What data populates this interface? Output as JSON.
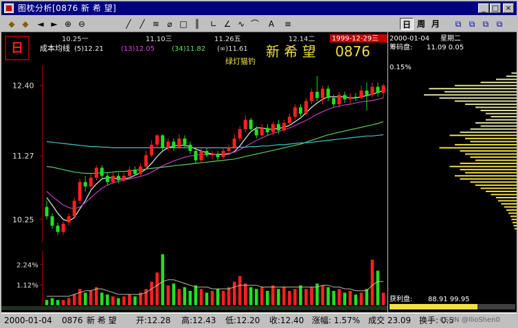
{
  "window": {
    "title": "图枕分析[0876 新 希 望]",
    "min": "_",
    "max": "□",
    "close": "×"
  },
  "toolbar": {
    "tools": [
      "◆",
      "◆",
      "◄",
      "►",
      "⊕",
      "⊖",
      "╱",
      "╱",
      "≋",
      "⌀",
      "□",
      "║",
      "∟",
      "∠",
      "∿",
      "⌒",
      "A",
      "≡"
    ],
    "periods": [
      "日",
      "周",
      "月"
    ],
    "views": [
      "⧉",
      "⧉",
      "⧉",
      "⧉"
    ]
  },
  "chart_header": {
    "dates": [
      "10.25一",
      "11.10三",
      "11.26五",
      "12.14二"
    ],
    "current_date": "1999-12-29三",
    "indicator_label": "成本均线",
    "ma": [
      {
        "label": "(5)12.21",
        "color": "#f0f0f0"
      },
      {
        "label": "(13)12.05",
        "color": "#e040e0"
      },
      {
        "label": "(34)11.82",
        "color": "#60e060"
      },
      {
        "label": "(∞)11.61",
        "color": "#e0e0e0"
      }
    ],
    "stock_name": "新 希 望",
    "stock_code": "0876",
    "signal_label": "绿灯猫钓"
  },
  "chart_data": {
    "type": "candlestick",
    "title": "",
    "y_ticks": [
      12.4,
      11.27,
      10.25
    ],
    "ylim": [
      9.95,
      12.65
    ],
    "candles": [
      [
        10.45,
        10.3,
        10.55,
        10.25
      ],
      [
        10.3,
        10.15,
        10.35,
        10.1
      ],
      [
        10.15,
        10.05,
        10.2,
        10.0
      ],
      [
        10.05,
        10.18,
        10.22,
        10.0
      ],
      [
        10.2,
        10.3,
        10.35,
        10.15
      ],
      [
        10.3,
        10.55,
        10.6,
        10.28
      ],
      [
        10.55,
        10.85,
        10.9,
        10.5
      ],
      [
        10.85,
        10.78,
        10.95,
        10.7
      ],
      [
        10.78,
        10.92,
        10.98,
        10.75
      ],
      [
        10.92,
        11.08,
        11.12,
        10.88
      ],
      [
        11.08,
        10.95,
        11.12,
        10.9
      ],
      [
        10.95,
        10.85,
        11.0,
        10.8
      ],
      [
        10.85,
        10.95,
        11.0,
        10.82
      ],
      [
        10.95,
        10.88,
        11.0,
        10.83
      ],
      [
        10.88,
        10.95,
        11.0,
        10.85
      ],
      [
        10.95,
        11.05,
        11.1,
        10.9
      ],
      [
        11.05,
        10.98,
        11.1,
        10.95
      ],
      [
        10.98,
        11.1,
        11.15,
        10.95
      ],
      [
        11.1,
        11.28,
        11.35,
        11.05
      ],
      [
        11.28,
        11.45,
        11.52,
        11.25
      ],
      [
        11.45,
        11.6,
        11.62,
        11.4
      ],
      [
        11.6,
        11.4,
        11.62,
        11.35
      ],
      [
        11.4,
        11.5,
        11.55,
        11.35
      ],
      [
        11.5,
        11.4,
        11.55,
        11.35
      ],
      [
        11.4,
        11.55,
        11.62,
        11.38
      ],
      [
        11.55,
        11.45,
        11.6,
        11.4
      ],
      [
        11.45,
        11.35,
        11.5,
        11.3
      ],
      [
        11.35,
        11.2,
        11.4,
        11.15
      ],
      [
        11.2,
        11.35,
        11.4,
        11.15
      ],
      [
        11.35,
        11.28,
        11.4,
        11.25
      ],
      [
        11.28,
        11.3,
        11.35,
        11.22
      ],
      [
        11.3,
        11.25,
        11.35,
        11.2
      ],
      [
        11.25,
        11.35,
        11.4,
        11.22
      ],
      [
        11.35,
        11.4,
        11.45,
        11.3
      ],
      [
        11.4,
        11.55,
        11.62,
        11.38
      ],
      [
        11.55,
        11.7,
        11.75,
        11.5
      ],
      [
        11.7,
        11.85,
        11.92,
        11.65
      ],
      [
        11.85,
        11.7,
        11.88,
        11.65
      ],
      [
        11.7,
        11.6,
        11.75,
        11.55
      ],
      [
        11.6,
        11.72,
        11.78,
        11.58
      ],
      [
        11.72,
        11.65,
        11.78,
        11.6
      ],
      [
        11.65,
        11.78,
        11.82,
        11.6
      ],
      [
        11.78,
        11.68,
        11.85,
        11.62
      ],
      [
        11.68,
        11.8,
        11.85,
        11.65
      ],
      [
        11.8,
        11.9,
        11.95,
        11.75
      ],
      [
        11.9,
        12.05,
        12.1,
        11.85
      ],
      [
        12.05,
        11.95,
        12.1,
        11.9
      ],
      [
        11.95,
        12.15,
        12.2,
        11.92
      ],
      [
        12.15,
        12.3,
        12.35,
        12.1
      ],
      [
        12.3,
        12.2,
        12.55,
        12.15
      ],
      [
        12.2,
        12.35,
        12.4,
        12.1
      ],
      [
        12.35,
        12.2,
        12.4,
        12.15
      ],
      [
        12.2,
        12.1,
        12.25,
        12.05
      ],
      [
        12.1,
        12.25,
        12.3,
        12.05
      ],
      [
        12.25,
        12.18,
        12.3,
        12.12
      ],
      [
        12.18,
        12.22,
        12.28,
        12.1
      ],
      [
        12.22,
        12.2,
        12.28,
        12.15
      ],
      [
        12.2,
        12.32,
        12.4,
        12.18
      ],
      [
        12.32,
        12.25,
        12.45,
        12.0
      ],
      [
        12.25,
        12.38,
        12.45,
        12.2
      ],
      [
        12.38,
        12.28,
        12.45,
        12.22
      ],
      [
        12.28,
        12.4,
        12.43,
        12.2
      ]
    ],
    "ma_lines": [
      {
        "name": "(5)",
        "color": "#f0f0f0",
        "values": [
          10.6,
          10.48,
          10.35,
          10.25,
          10.22,
          10.28,
          10.42,
          10.55,
          10.72,
          10.82,
          10.9,
          10.92,
          10.92,
          10.9,
          10.9,
          10.92,
          10.96,
          11.0,
          11.06,
          11.15,
          11.26,
          11.35,
          11.4,
          11.43,
          11.44,
          11.44,
          11.42,
          11.38,
          11.35,
          11.32,
          11.3,
          11.29,
          11.29,
          11.3,
          11.34,
          11.43,
          11.55,
          11.66,
          11.72,
          11.72,
          11.7,
          11.7,
          11.71,
          11.73,
          11.76,
          11.82,
          11.88,
          11.96,
          12.05,
          12.12,
          12.18,
          12.22,
          12.22,
          12.22,
          12.22,
          12.2,
          12.2,
          12.22,
          12.24,
          12.26,
          12.29,
          12.32
        ]
      },
      {
        "name": "(13)",
        "color": "#c040c0",
        "values": [
          10.7,
          10.62,
          10.55,
          10.48,
          10.44,
          10.42,
          10.45,
          10.52,
          10.6,
          10.68,
          10.75,
          10.8,
          10.84,
          10.86,
          10.88,
          10.9,
          10.92,
          10.94,
          10.97,
          11.01,
          11.06,
          11.11,
          11.15,
          11.19,
          11.22,
          11.25,
          11.27,
          11.28,
          11.29,
          11.29,
          11.29,
          11.3,
          11.3,
          11.31,
          11.33,
          11.37,
          11.42,
          11.47,
          11.52,
          11.56,
          11.6,
          11.63,
          11.66,
          11.69,
          11.72,
          11.76,
          11.8,
          11.84,
          11.89,
          11.94,
          11.98,
          12.02,
          12.05,
          12.07,
          12.09,
          12.1,
          12.12,
          12.14,
          12.15,
          12.16,
          12.18,
          12.2
        ]
      },
      {
        "name": "(34)",
        "color": "#60d060",
        "values": [
          11.1,
          11.09,
          11.07,
          11.05,
          11.03,
          11.01,
          11.0,
          10.99,
          10.99,
          10.99,
          11.0,
          11.0,
          11.01,
          11.02,
          11.02,
          11.03,
          11.04,
          11.05,
          11.06,
          11.07,
          11.08,
          11.09,
          11.1,
          11.11,
          11.12,
          11.13,
          11.14,
          11.15,
          11.16,
          11.17,
          11.18,
          11.19,
          11.2,
          11.21,
          11.22,
          11.24,
          11.26,
          11.28,
          11.3,
          11.32,
          11.34,
          11.36,
          11.38,
          11.4,
          11.42,
          11.44,
          11.46,
          11.49,
          11.52,
          11.55,
          11.58,
          11.61,
          11.63,
          11.65,
          11.67,
          11.69,
          11.71,
          11.73,
          11.75,
          11.77,
          11.79,
          11.82
        ]
      },
      {
        "name": "(∞)",
        "color": "#40c8c8",
        "values": [
          11.5,
          11.49,
          11.48,
          11.47,
          11.46,
          11.45,
          11.44,
          11.43,
          11.42,
          11.42,
          11.41,
          11.41,
          11.4,
          11.4,
          11.4,
          11.4,
          11.4,
          11.4,
          11.4,
          11.4,
          11.4,
          11.4,
          11.4,
          11.4,
          11.4,
          11.4,
          11.4,
          11.4,
          11.4,
          11.4,
          11.4,
          11.4,
          11.4,
          11.4,
          11.4,
          11.41,
          11.41,
          11.42,
          11.42,
          11.43,
          11.43,
          11.44,
          11.45,
          11.45,
          11.46,
          11.47,
          11.48,
          11.48,
          11.49,
          11.5,
          11.51,
          11.52,
          11.53,
          11.54,
          11.55,
          11.56,
          11.57,
          11.58,
          11.59,
          11.59,
          11.6,
          11.61
        ]
      }
    ],
    "volume_ticks": [
      "2.24%",
      "1.12%"
    ],
    "volume_ylim": [
      0,
      3.0
    ],
    "volume": [
      0.3,
      0.4,
      0.3,
      0.3,
      0.4,
      0.6,
      0.9,
      0.7,
      0.8,
      1.0,
      0.7,
      0.6,
      0.5,
      0.4,
      0.5,
      0.6,
      0.5,
      0.7,
      0.9,
      1.3,
      1.8,
      2.8,
      1.1,
      1.2,
      0.9,
      1.0,
      0.8,
      1.1,
      0.9,
      0.7,
      0.8,
      0.9,
      0.8,
      1.0,
      1.3,
      1.6,
      1.2,
      1.0,
      0.9,
      1.0,
      0.8,
      1.1,
      0.9,
      1.0,
      0.8,
      0.9,
      1.1,
      0.9,
      1.0,
      1.2,
      1.1,
      1.0,
      0.8,
      0.9,
      0.7,
      0.8,
      0.6,
      0.7,
      0.9,
      2.5,
      1.9,
      0.7
    ],
    "volume_ma": [
      0.5,
      0.5,
      0.5,
      0.5,
      0.5,
      0.6,
      0.7,
      0.8,
      0.8,
      0.9,
      0.9,
      0.8,
      0.7,
      0.6,
      0.6,
      0.6,
      0.6,
      0.6,
      0.7,
      0.9,
      1.1,
      1.3,
      1.4,
      1.4,
      1.3,
      1.2,
      1.1,
      1.0,
      1.0,
      1.0,
      0.9,
      0.9,
      0.9,
      0.9,
      1.0,
      1.1,
      1.1,
      1.1,
      1.1,
      1.0,
      1.0,
      1.0,
      1.0,
      1.0,
      1.0,
      1.0,
      1.0,
      1.0,
      1.0,
      1.0,
      1.1,
      1.1,
      1.0,
      1.0,
      0.9,
      0.9,
      0.8,
      0.8,
      0.8,
      1.1,
      1.3,
      1.3
    ]
  },
  "side": {
    "date": "2000-01-04",
    "weekday": "星期二",
    "range_label": "筹码盘:",
    "range_values": "11.09 0.05",
    "pct": "0.15%",
    "profit_label": "获利盘:",
    "profit_values": "88.91 99.95",
    "distribution": [
      {
        "price": 12.6,
        "v": 0.05
      },
      {
        "price": 12.55,
        "v": 0.1
      },
      {
        "price": 12.5,
        "v": 0.2
      },
      {
        "price": 12.45,
        "v": 0.35
      },
      {
        "price": 12.4,
        "v": 0.6
      },
      {
        "price": 12.35,
        "v": 0.85
      },
      {
        "price": 12.3,
        "v": 0.7
      },
      {
        "price": 12.25,
        "v": 0.9
      },
      {
        "price": 12.2,
        "v": 0.75
      },
      {
        "price": 12.15,
        "v": 0.6
      },
      {
        "price": 12.1,
        "v": 0.5
      },
      {
        "price": 12.05,
        "v": 0.4
      },
      {
        "price": 12.0,
        "v": 0.35
      },
      {
        "price": 11.95,
        "v": 0.3
      },
      {
        "price": 11.9,
        "v": 0.25
      },
      {
        "price": 11.85,
        "v": 0.3
      },
      {
        "price": 11.8,
        "v": 0.4
      },
      {
        "price": 11.75,
        "v": 0.35
      },
      {
        "price": 11.7,
        "v": 0.45
      },
      {
        "price": 11.65,
        "v": 0.55
      },
      {
        "price": 11.6,
        "v": 0.65
      },
      {
        "price": 11.55,
        "v": 0.5
      },
      {
        "price": 11.5,
        "v": 0.45
      },
      {
        "price": 11.45,
        "v": 0.6
      },
      {
        "price": 11.4,
        "v": 0.75
      },
      {
        "price": 11.35,
        "v": 0.55
      },
      {
        "price": 11.3,
        "v": 0.5
      },
      {
        "price": 11.25,
        "v": 0.45
      },
      {
        "price": 11.2,
        "v": 0.4
      },
      {
        "price": 11.15,
        "v": 0.55
      },
      {
        "price": 11.1,
        "v": 0.65
      },
      {
        "price": 11.05,
        "v": 0.55
      },
      {
        "price": 11.0,
        "v": 0.5
      },
      {
        "price": 10.95,
        "v": 0.6
      },
      {
        "price": 10.9,
        "v": 0.55
      },
      {
        "price": 10.85,
        "v": 0.45
      },
      {
        "price": 10.8,
        "v": 0.4
      },
      {
        "price": 10.75,
        "v": 0.35
      },
      {
        "price": 10.7,
        "v": 0.3
      },
      {
        "price": 10.65,
        "v": 0.25
      },
      {
        "price": 10.6,
        "v": 0.2
      },
      {
        "price": 10.55,
        "v": 0.18
      },
      {
        "price": 10.5,
        "v": 0.15
      },
      {
        "price": 10.45,
        "v": 0.12
      },
      {
        "price": 10.4,
        "v": 0.1
      },
      {
        "price": 10.35,
        "v": 0.08
      },
      {
        "price": 10.3,
        "v": 0.06
      },
      {
        "price": 10.25,
        "v": 0.05
      },
      {
        "price": 10.2,
        "v": 0.04
      },
      {
        "price": 10.15,
        "v": 0.03
      },
      {
        "price": 10.1,
        "v": 0.02
      }
    ]
  },
  "status": {
    "date": "2000-01-04",
    "code": "0876",
    "name": "新 希 望",
    "open": "开:12.28",
    "high": "高:12.43",
    "low": "低:12.20",
    "close": "收:12.40",
    "change": "涨幅:   1.57%",
    "amount": "成交  23.09",
    "turnover": "换手: 0.5",
    "watermark": "CSDN @IlioShen0"
  },
  "colors": {
    "up": "#ff2020",
    "down": "#20e020",
    "bg": "#000000",
    "axis": "#c00000"
  }
}
